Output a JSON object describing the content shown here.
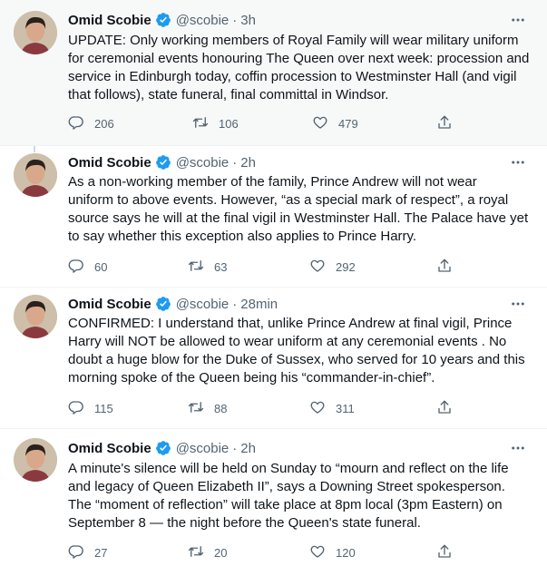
{
  "tweets": [
    {
      "author": "Omid Scobie",
      "handle": "@scobie",
      "separator": "·",
      "time": "3h",
      "lines": [
        "UPDATE: Only working members of Royal Family will wear military uniform",
        "for ceremonial events honouring The Queen over next week: procession and",
        "service in Edinburgh today, coffin procession to Westminster Hall (and vigil",
        "that follows), state funeral, final committal in Windsor."
      ],
      "replies": "206",
      "retweets": "106",
      "likes": "479"
    },
    {
      "author": "Omid Scobie",
      "handle": "@scobie",
      "separator": "·",
      "time": "2h",
      "lines": [
        "As a non-working member of the family, Prince Andrew will not wear",
        "uniform to above events. However, “as a special mark of respect”, a royal",
        "source says he will at the final vigil in Westminster Hall. The Palace have yet",
        "to say whether this exception also applies to Prince Harry."
      ],
      "replies": "60",
      "retweets": "63",
      "likes": "292"
    },
    {
      "author": "Omid Scobie",
      "handle": "@scobie",
      "separator": "·",
      "time": "28min",
      "lines": [
        "CONFIRMED: I understand that, unlike Prince Andrew at final vigil, Prince",
        "Harry will NOT be allowed to wear uniform at any ceremonial events . No",
        "doubt a huge blow for the Duke of Sussex, who served for 10 years and this",
        "morning spoke of the Queen being his “commander-in-chief”."
      ],
      "replies": "115",
      "retweets": "88",
      "likes": "311"
    },
    {
      "author": "Omid Scobie",
      "handle": "@scobie",
      "separator": "·",
      "time": "2h",
      "lines": [
        "A minute's silence will be held on Sunday to “mourn and reflect on the life",
        "and legacy of Queen Elizabeth II”, says a Downing Street spokesperson.",
        "The “moment of reflection” will take place at 8pm local (3pm Eastern) on",
        "September 8 — the night before the Queen's state funeral."
      ],
      "replies": "27",
      "retweets": "20",
      "likes": "120"
    }
  ],
  "colors": {
    "verified": "#1d9bf0",
    "muted_text": "#536471",
    "highlight_background": "#f7f9f9",
    "thread_line": "#cfd9de"
  },
  "icons": {
    "reply": "reply-icon",
    "retweet": "retweet-icon",
    "like": "like-icon",
    "share": "share-icon",
    "more": "more-options-icon",
    "verified": "verified-badge-icon"
  }
}
